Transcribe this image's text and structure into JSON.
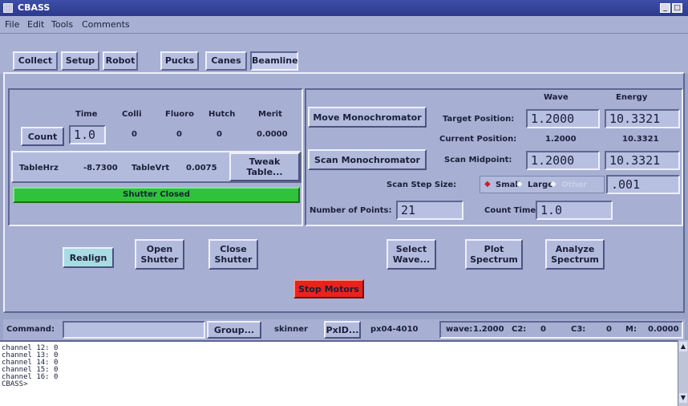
{
  "window": {
    "title": "CBASS"
  },
  "menu": [
    "File",
    "Edit",
    "Tools",
    "Comments"
  ],
  "tabs": [
    "Collect",
    "Setup",
    "Robot",
    "Pucks",
    "Canes",
    "Beamline"
  ],
  "counts": {
    "headers": [
      "Time",
      "Colli",
      "Fluoro",
      "Hutch",
      "Merit"
    ],
    "count_button": "Count",
    "time_value": "1.0",
    "colli": "0",
    "fluoro": "0",
    "hutch": "0",
    "merit": "0.0000"
  },
  "table": {
    "hrz_label": "TableHrz",
    "hrz_value": "-8.7300",
    "vrt_label": "TableVrt",
    "vrt_value": "0.0075",
    "tweak_button": "Tweak\nTable..."
  },
  "shutter_status": "Shutter Closed",
  "mono": {
    "col_wave": "Wave",
    "col_energy": "Energy",
    "move_button": "Move Monochromator",
    "target_label": "Target Position:",
    "target_wave": "1.2000",
    "target_energy": "10.3321",
    "current_label": "Current Position:",
    "current_wave": "1.2000",
    "current_energy": "10.3321",
    "scan_button": "Scan Monochromator",
    "midpoint_label": "Scan Midpoint:",
    "mid_wave": "1.2000",
    "mid_energy": "10.3321",
    "step_label": "Scan Step Size:",
    "step_small": "Small",
    "step_large": "Large",
    "step_other": "Other",
    "step_value": ".001",
    "points_label": "Number of Points:",
    "points_value": "21",
    "count_time_label": "Count Time:",
    "count_time_value": "1.0"
  },
  "actions": {
    "realign": "Realign",
    "open_shutter": "Open\nShutter",
    "close_shutter": "Close\nShutter",
    "select_wave": "Select\nWave...",
    "plot_spectrum": "Plot\nSpectrum",
    "analyze_spectrum": "Analyze\nSpectrum",
    "stop_motors": "Stop Motors"
  },
  "command": {
    "label": "Command:",
    "value": "",
    "group_button": "Group...",
    "user": "skinner",
    "pxid_button": "PxID...",
    "pxid_value": "px04-4010",
    "status": {
      "wave_label": "wave:",
      "wave": "1.2000",
      "c2_label": "C2:",
      "c2": "0",
      "c3_label": "C3:",
      "c3": "0",
      "m_label": "M:",
      "m": "0.0000"
    }
  },
  "console": {
    "lines": [
      "channel 12: 0",
      "channel 13: 0",
      "channel 14: 0",
      "channel 15: 0",
      "channel 16: 0",
      "CBASS>"
    ]
  },
  "colors": {
    "shutter_green": "#2fc23a",
    "stop_red": "#e8231c",
    "realign_cyan": "#a9dbe4"
  }
}
